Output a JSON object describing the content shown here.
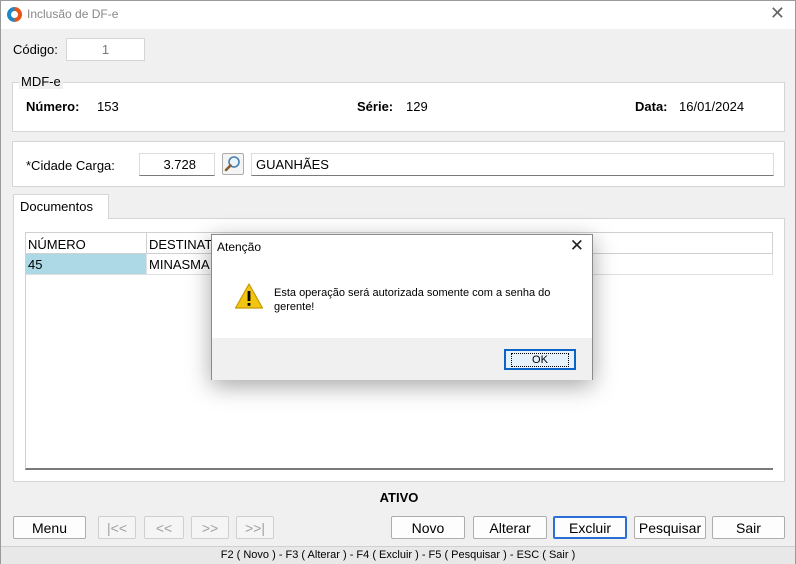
{
  "window": {
    "title": "Inclusão de DF-e"
  },
  "codigo": {
    "label": "Código:",
    "value": "1"
  },
  "mdfe": {
    "caption": "MDF-e",
    "numero_label": "Número:",
    "numero_value": "153",
    "serie_label": "Série:",
    "serie_value": "129",
    "data_label": "Data:",
    "data_value": "16/01/2024"
  },
  "cidade": {
    "label": "*Cidade Carga:",
    "code": "3.728",
    "name": "GUANHÃES",
    "search_icon": "magnifier-icon"
  },
  "tabs": [
    {
      "label": "Documentos"
    }
  ],
  "grid": {
    "columns": [
      "NÚMERO",
      "DESTINAT"
    ],
    "rows": [
      {
        "numero": "45",
        "destinatario": "MINASMA"
      }
    ]
  },
  "status": "ATIVO",
  "buttons": {
    "menu": "Menu",
    "first": "|<<",
    "prev": "<<",
    "next": ">>",
    "last": ">>|",
    "novo": "Novo",
    "alterar": "Alterar",
    "excluir": "Excluir",
    "pesquisar": "Pesquisar",
    "sair": "Sair"
  },
  "shortcuts": "F2 ( Novo )  -  F3 ( Alterar )  -  F4 ( Excluir )  -  F5 ( Pesquisar )  -  ESC ( Sair )",
  "dialog": {
    "title": "Atenção",
    "message": "Esta operação será autorizada somente com a senha do gerente!",
    "ok_label": "OK",
    "icon": "warning-icon",
    "warning_color": "#f2c511"
  }
}
